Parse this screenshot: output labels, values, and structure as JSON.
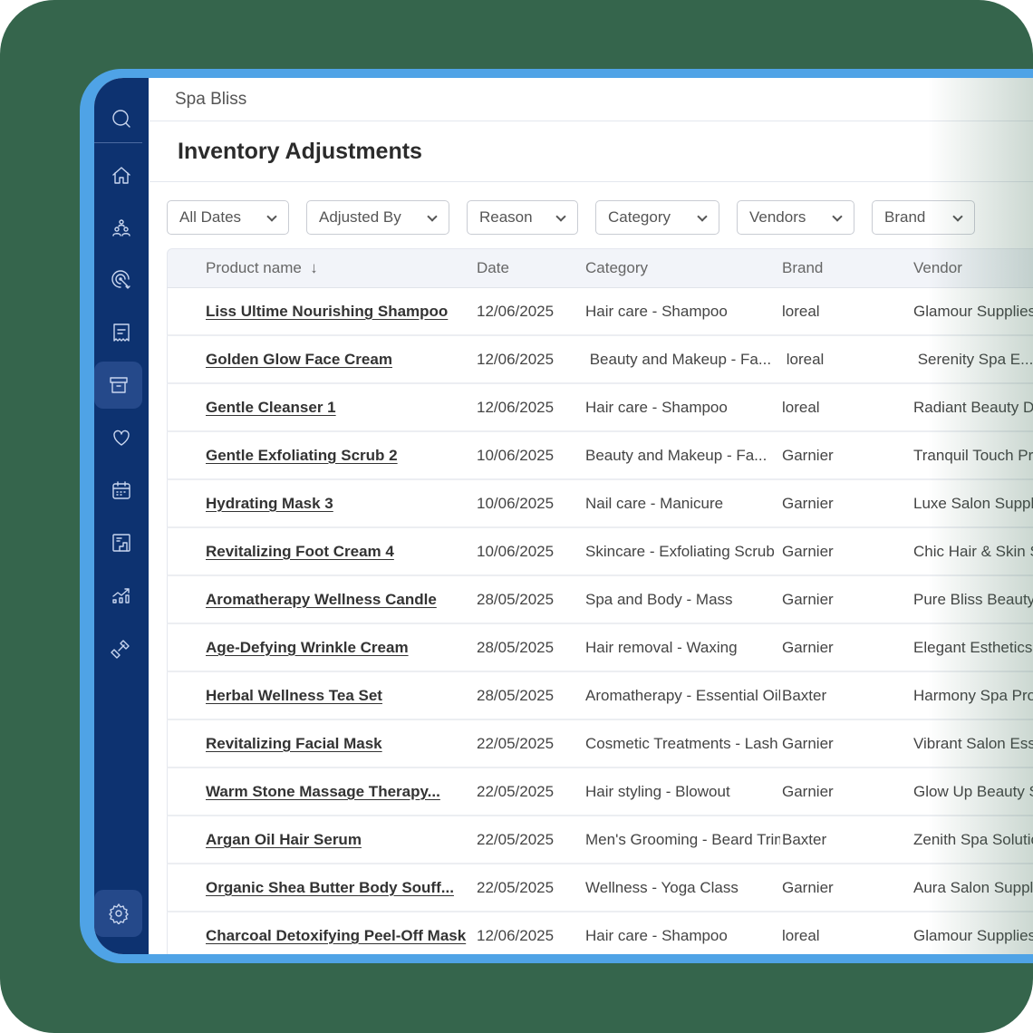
{
  "app": {
    "name": "Spa Bliss",
    "page_title": "Inventory Adjustments"
  },
  "sidebar": {
    "items": [
      "search-icon",
      "home-icon",
      "users-icon",
      "target-icon",
      "receipt-icon",
      "inventory-icon",
      "heart-icon",
      "calendar-icon",
      "report-icon",
      "analytics-icon",
      "dumbbell-icon",
      "gear-icon"
    ],
    "active": "inventory-icon"
  },
  "filters": [
    "All Dates",
    "Adjusted By",
    "Reason",
    "Category",
    "Vendors",
    "Brand"
  ],
  "table": {
    "columns": [
      "Product name",
      "Date",
      "Category",
      "Brand",
      "Vendor"
    ],
    "sort_indicator": "↓",
    "rows": [
      [
        "Liss Ultime Nourishing Shampoo",
        "12/06/2025",
        "Hair care - Shampoo",
        "loreal",
        "Glamour Supplies"
      ],
      [
        "Golden Glow Face Cream",
        "12/06/2025",
        " Beauty and Makeup - Fa...",
        " loreal",
        " Serenity Spa E..."
      ],
      [
        "Gentle Cleanser 1",
        "12/06/2025",
        "Hair care - Shampoo",
        "loreal",
        "Radiant Beauty Di"
      ],
      [
        "Gentle Exfoliating Scrub 2",
        "10/06/2025",
        "Beauty and Makeup - Fa...",
        "Garnier",
        "Tranquil Touch Pro"
      ],
      [
        "Hydrating Mask 3",
        "10/06/2025",
        "Nail care - Manicure",
        "Garnier",
        "Luxe Salon Supplie"
      ],
      [
        "Revitalizing Foot Cream 4",
        "10/06/2025",
        "Skincare - Exfoliating Scrub",
        "Garnier",
        "Chic Hair & Skin S"
      ],
      [
        "Aromatherapy Wellness Candle",
        "28/05/2025",
        "Spa and Body - Mass",
        "Garnier",
        "Pure Bliss Beauty"
      ],
      [
        "Age-Defying Wrinkle Cream",
        "28/05/2025",
        "Hair removal - Waxing",
        "Garnier",
        "Elegant Esthetics S"
      ],
      [
        "Herbal Wellness Tea Set",
        "28/05/2025",
        "Aromatherapy - Essential Oil",
        "Baxter",
        "Harmony Spa Prod"
      ],
      [
        "Revitalizing Facial Mask",
        "22/05/2025",
        "Cosmetic Treatments - Lash L",
        "Garnier",
        "Vibrant Salon Esse"
      ],
      [
        "Warm Stone Massage Therapy...",
        "22/05/2025",
        "Hair styling - Blowout",
        "Garnier",
        "Glow Up Beauty S"
      ],
      [
        "Argan Oil Hair Serum",
        "22/05/2025",
        "Men's Grooming - Beard Trim",
        "Baxter",
        "Zenith Spa Solutio"
      ],
      [
        "Organic Shea Butter Body Souff...",
        "22/05/2025",
        "Wellness - Yoga Class",
        "Garnier",
        "Aura Salon Supplie"
      ],
      [
        "Charcoal Detoxifying Peel-Off Mask",
        "12/06/2025",
        "Hair care - Shampoo",
        "loreal",
        "Glamour Supplies"
      ]
    ]
  },
  "colors": {
    "background": "#35654c",
    "frame": "#4fa3e6",
    "sidebar": "#0d3270",
    "active": "#25498a"
  }
}
